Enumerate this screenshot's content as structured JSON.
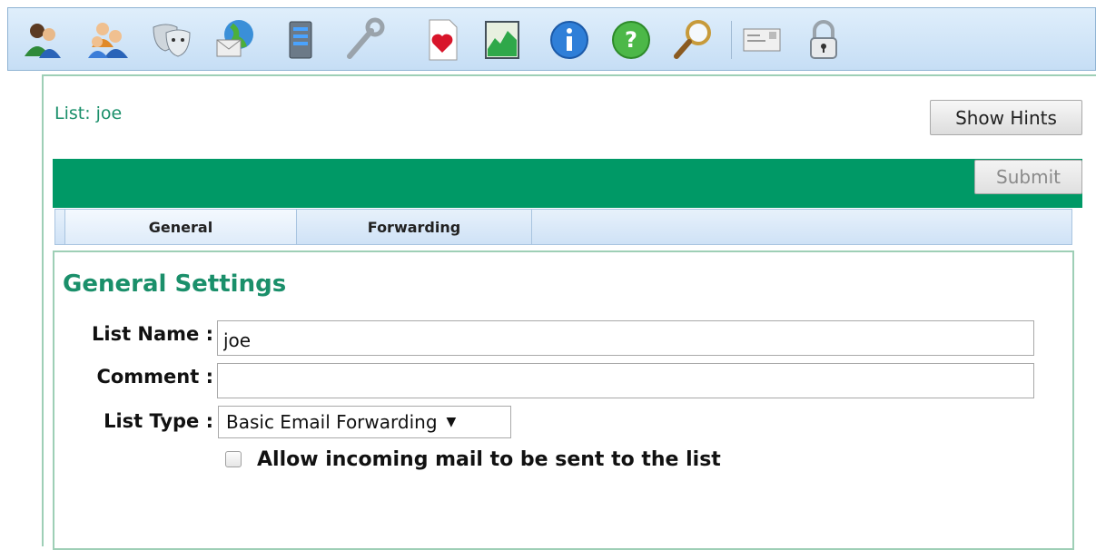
{
  "toolbar": {
    "icons": [
      {
        "name": "users-icon"
      },
      {
        "name": "user-group-icon"
      },
      {
        "name": "theater-masks-icon"
      },
      {
        "name": "globe-mail-icon"
      },
      {
        "name": "server-icon"
      },
      {
        "name": "wrench-icon"
      },
      {
        "name": "favorites-heart-icon"
      },
      {
        "name": "chart-graph-icon"
      },
      {
        "name": "info-icon"
      },
      {
        "name": "help-icon"
      },
      {
        "name": "search-magnifier-icon"
      },
      {
        "name": "envelope-letter-icon"
      },
      {
        "name": "padlock-icon"
      }
    ]
  },
  "header": {
    "list_title": "List: joe",
    "show_hints_label": "Show Hints",
    "submit_label": "Submit"
  },
  "tabs": [
    {
      "label": "General",
      "active": true
    },
    {
      "label": "Forwarding",
      "active": false
    }
  ],
  "form": {
    "section_title": "General Settings",
    "list_name_label": "List Name :",
    "list_name_value": "joe",
    "comment_label": "Comment :",
    "comment_value": "",
    "list_type_label": "List Type :",
    "list_type_value": "Basic Email Forwarding",
    "allow_incoming_label": "Allow incoming mail to be sent to the list",
    "allow_incoming_checked": false
  },
  "colors": {
    "accent_green": "#009966",
    "title_green": "#1a8f6a",
    "toolbar_blue": "#c6def5"
  }
}
